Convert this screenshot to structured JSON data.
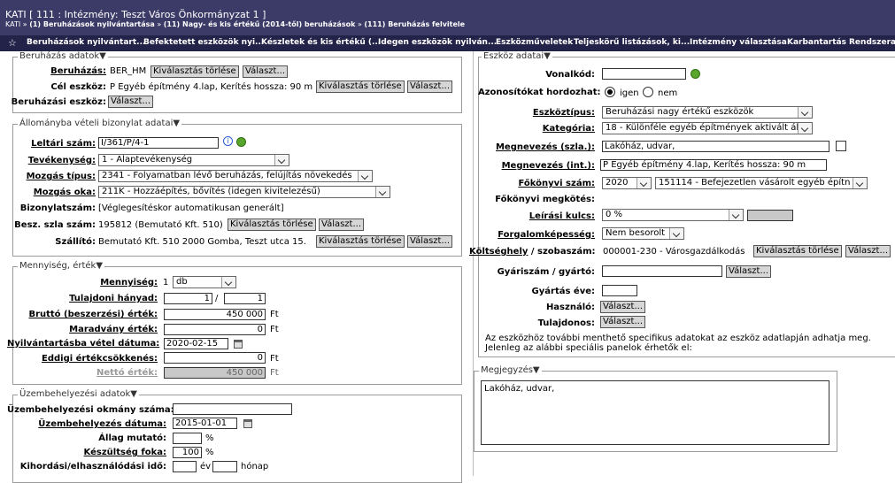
{
  "header": {
    "title": "KATI [ 111 : Intézmény: Teszt Város Önkormányzat 1 ]",
    "crumb_prefix": "KATI » ",
    "crumb_1": "(1) Beruházások nyilvántartása",
    "crumb_mid1": " » ",
    "crumb_2": "(11) Nagy- és kis értékű (2014-től) beruházások",
    "crumb_mid2": " » ",
    "crumb_3": "(111) Beruházás felvitele"
  },
  "menu": {
    "star": "☆",
    "items": [
      "Beruházások nyilvántart...",
      "Befektetett eszközök nyi...",
      "Készletek és kis értékű (...",
      "Idegen eszközök nyilván...",
      "Eszközműveletek",
      "Teljeskörű listázások, ki...",
      "Intézmény választása",
      "Karbantartás",
      "Rendszeradm"
    ]
  },
  "common": {
    "clear": "Kiválasztás törlése",
    "choose": "Választ..."
  },
  "beruhazas": {
    "legend": "Beruházás adatok▼",
    "beruhazas_label": "Beruházás:",
    "beruhazas_value": "BER_HM",
    "cel_label": "Cél eszköz:",
    "cel_value": "P Egyéb építmény 4.lap, Kerítés hossza: 90 m",
    "eszkoz_label": "Beruházási eszköz:"
  },
  "allomany": {
    "legend": "Állományba vételi bizonylat adatai▼",
    "leltari_label": "Leltári szám:",
    "leltari_value": "I/361/P/4-1",
    "tevekenyseg_label": "Tevékenység:",
    "tevekenyseg_value": "1 - Alaptevékenység",
    "mozgastipus_label": "Mozgás típus:",
    "mozgastipus_value": "2341 - Folyamatban lévő beruházás, felújítás növekedés",
    "mozgasok_label": "Mozgás oka:",
    "mozgasok_value": "211K - Hozzáépítés, bővítés (idegen kivitelezésű)",
    "bizonylat_label": "Bizonylatszám:",
    "bizonylat_value": "[Véglegesítéskor automatikusan generált]",
    "besz_label": "Besz. szla szám:",
    "besz_value": "195812 (Bemutató Kft. 510)",
    "szallito_label": "Szállító:",
    "szallito_value": "Bemutató Kft. 510 2000 Gomba, Teszt utca 15."
  },
  "mennyiseg": {
    "legend": "Mennyiség, érték▼",
    "menny_label": "Mennyiség:",
    "menny_value": "1",
    "menny_unit": "db",
    "tul_label": "Tulajdoni hányad:",
    "tul_a": "1",
    "tul_sep": "/",
    "tul_b": "1",
    "brutto_label": "Bruttó (beszerzési) érték:",
    "brutto_value": "450 000",
    "maradvany_label": "Maradvány érték:",
    "maradvany_value": "0",
    "nyilv_label": "Nyilvántartásba vétel dátuma:",
    "nyilv_value": "2020-02-15",
    "eddigi_label": "Eddigi értékcsökkenés:",
    "eddigi_value": "0",
    "netto_label": "Nettó érték:",
    "netto_value": "450 000",
    "currency": "Ft"
  },
  "uzembe": {
    "legend": "Üzembehelyezési adatok▼",
    "okmany_label": "Üzembehelyezési okmány száma:",
    "datum_label": "Üzembehelyezés dátuma:",
    "datum_value": "2015-01-01",
    "allag_label": "Állag mutató:",
    "keszult_label": "Készültség foka:",
    "keszult_value": "100",
    "pct": "%",
    "kihord_label": "Kihordási/elhasználódási idő:",
    "ev": "év",
    "honap": "hónap"
  },
  "eszkoz": {
    "legend": "Eszköz adatai▼",
    "vonalkod_label": "Vonalkód:",
    "azon_label": "Azonosítókat hordozhat:",
    "igen": "igen",
    "nem": "nem",
    "tipus_label": "Eszköztípus:",
    "tipus_value": "Beruházási nagy értékű eszközök",
    "kat_label": "Kategória:",
    "kat_value": "18 - Különféle egyéb építmények aktivált ál",
    "megn_szla_label": "Megnevezés (szla.):",
    "megn_szla_value": "Lakóház, udvar,",
    "megn_int_label": "Megnevezés (int.):",
    "megn_int_value": "P Egyéb építmény 4.lap, Kerítés hossza: 90 m",
    "fokonyvi_label": "Főkönyvi szám:",
    "fokonyvi_year": "2020",
    "fokonyvi_value": "151114 - Befejezetlen vásárolt egyéb építn",
    "fokonyvi_megk_label": "Főkönyvi megkötés:",
    "leirasi_label": "Leírási kulcs:",
    "leirasi_value": "0 %",
    "forg_label": "Forgalomképesség:",
    "forg_value": "Nem besorolt",
    "kolts_label_1": "Költséghely",
    "kolts_label_2": " / szobaszám:",
    "kolts_value": "000001-230 - Városgazdálkodás",
    "gyari_label": "Gyáriszám / gyártó:",
    "gyev_label": "Gyártás éve:",
    "hasznalo_label": "Használó:",
    "tulajdonos_label": "Tulajdonos:",
    "note_1": "Az eszközhöz további menthető specifikus adatokat az eszköz adatlapján adhatja meg.",
    "note_2": "Jelenleg az alábbi speciális panelok érhetők el:"
  },
  "megjegyzes": {
    "legend": "Megjegyzés▼",
    "value": "Lakóház, udvar,"
  }
}
